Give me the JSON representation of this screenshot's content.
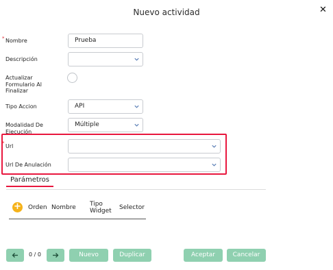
{
  "dialog": {
    "title": "Nuevo actividad",
    "close_label": "✕"
  },
  "form": {
    "required_mark": "*",
    "nombre": {
      "label": "Nombre",
      "value": "Prueba"
    },
    "descripcion": {
      "label": "Descripción",
      "value": ""
    },
    "actualizar": {
      "label_lines": [
        "Actualizar",
        "Formulario Al",
        "Finalizar"
      ]
    },
    "tipo_accion": {
      "label": "Tipo Accion",
      "value": "API"
    },
    "modalidad": {
      "label_lines": [
        "Modalidad De",
        "Ejecución"
      ],
      "value": "Múltiple"
    },
    "url": {
      "label": "Url",
      "value": ""
    },
    "url_anulacion": {
      "label": "Url De Anulación",
      "value": ""
    }
  },
  "tabs": {
    "parametros": "Parámetros"
  },
  "table": {
    "add_label": "+",
    "headers": {
      "orden": "Orden",
      "nombre": "Nombre",
      "tipo_widget_lines": [
        "Tipo",
        "Widget"
      ],
      "selector": "Selector"
    }
  },
  "footer": {
    "pager": "0 / 0",
    "nuevo": "Nuevo",
    "duplicar": "Duplicar",
    "aceptar": "Aceptar",
    "cancelar": "Cancelar"
  },
  "colors": {
    "accent_red": "#e8163d",
    "button_green": "#8fd0b0",
    "add_yellow": "#f5b21a"
  },
  "icons": {
    "close": "close-icon",
    "dropdown": "chevron-down-icon",
    "prev": "arrow-left-icon",
    "next": "arrow-right-icon",
    "add": "plus-icon"
  }
}
